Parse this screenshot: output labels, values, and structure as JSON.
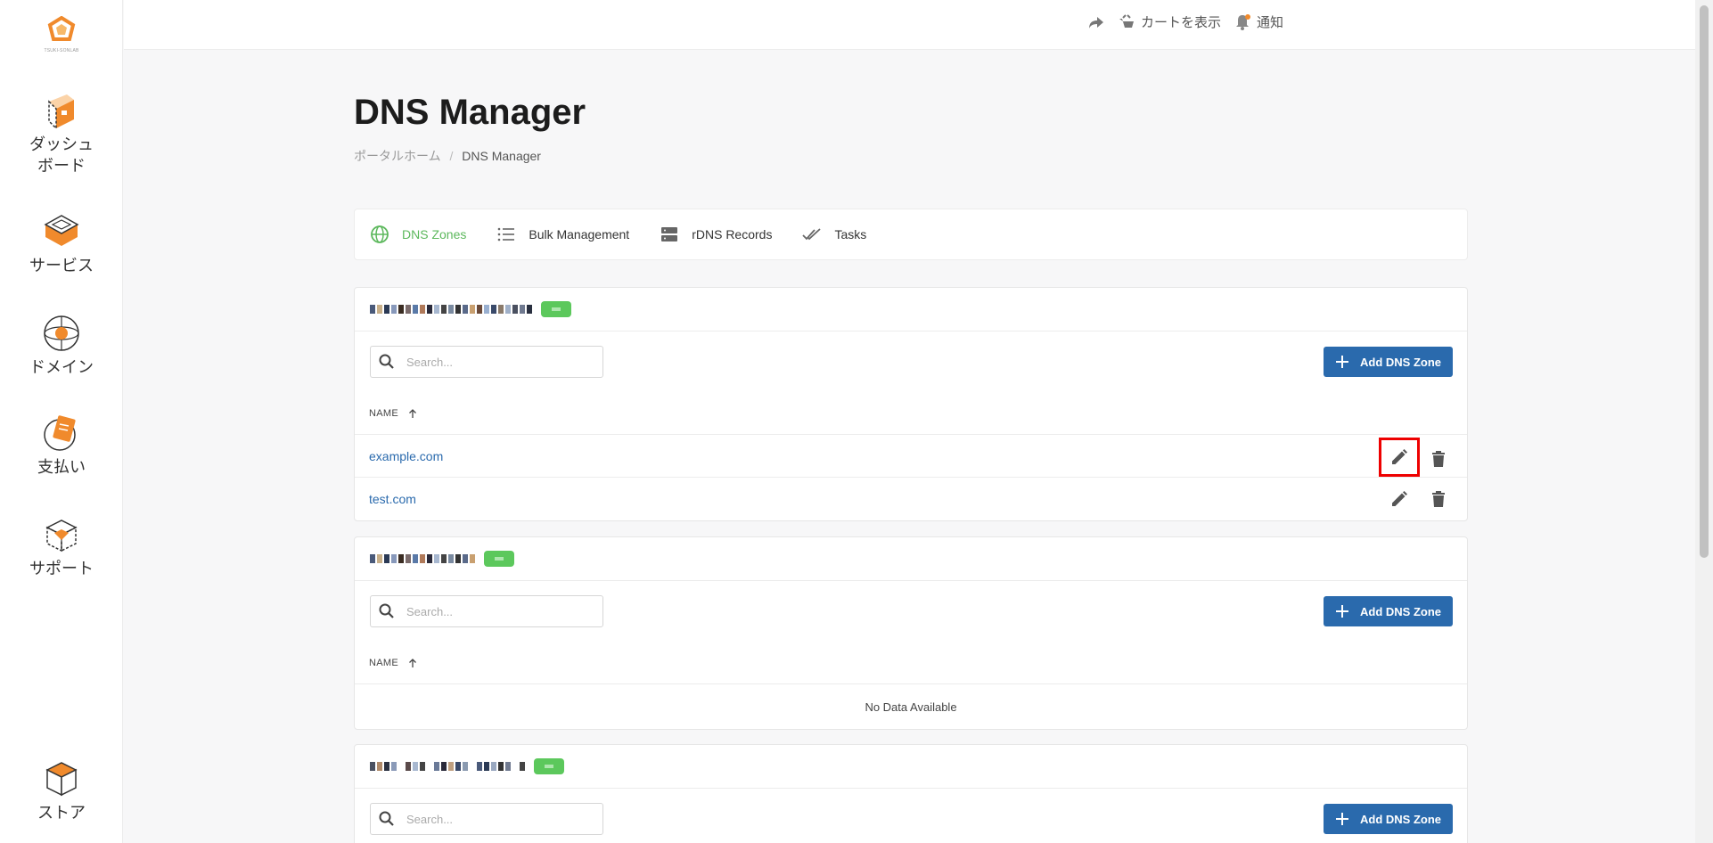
{
  "sidebar": {
    "logo_text": "TSUKI-SONLAB",
    "items": [
      {
        "label_lines": [
          "ダッシュ",
          "ボード"
        ],
        "icon": "dashboard-icon"
      },
      {
        "label": "サービス",
        "icon": "services-box-icon"
      },
      {
        "label": "ドメイン",
        "icon": "globe-icon"
      },
      {
        "label": "支払い",
        "icon": "payment-icon"
      },
      {
        "label": "サポート",
        "icon": "support-box-icon"
      },
      {
        "label": "ストア",
        "icon": "store-cube-icon"
      }
    ]
  },
  "topbar": {
    "cart_label": "カートを表示",
    "notify_label": "通知"
  },
  "page": {
    "title": "DNS Manager",
    "breadcrumb_home": "ポータルホーム",
    "breadcrumb_sep": "/",
    "breadcrumb_current": "DNS Manager"
  },
  "tabs": [
    {
      "label": "DNS Zones",
      "active": true,
      "icon": "globe-icon"
    },
    {
      "label": "Bulk Management",
      "active": false,
      "icon": "list-icon"
    },
    {
      "label": "rDNS Records",
      "active": false,
      "icon": "server-icon"
    },
    {
      "label": "Tasks",
      "active": false,
      "icon": "double-check-icon"
    }
  ],
  "cards": [
    {
      "search_placeholder": "Search...",
      "add_button": "Add DNS Zone",
      "column_name": "NAME",
      "rows": [
        "example.com",
        "test.com"
      ],
      "empty_text": ""
    },
    {
      "search_placeholder": "Search...",
      "add_button": "Add DNS Zone",
      "column_name": "NAME",
      "rows": [],
      "empty_text": "No Data Available"
    },
    {
      "search_placeholder": "Search...",
      "add_button": "Add DNS Zone"
    }
  ],
  "colors": {
    "accent_blue": "#2a6aad",
    "active_green": "#5cb85c",
    "brand_orange": "#f08a2c",
    "highlight_red": "#e00000"
  }
}
